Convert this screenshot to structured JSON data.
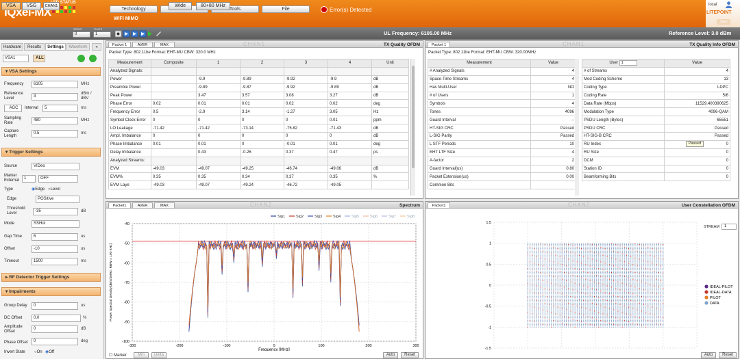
{
  "app": {
    "logo": "IQxel-MX",
    "led_status": "LED STATUS",
    "local": "local",
    "brand": "LITEPOINT",
    "save": "Save"
  },
  "menu": {
    "technology": "Technology",
    "admin": "Admin",
    "tools": "Tools",
    "file": "File",
    "mode": "WIFI MIMO",
    "error": "Error(s) Detected"
  },
  "toolbar": {
    "vsa": "VSA",
    "vsg": "VSG",
    "chan": "CHAN1",
    "select_label": "Select",
    "select_value": "0",
    "count_label": "Count",
    "count_value": "1",
    "wide": "Wide",
    "span": "80+80 MHz",
    "ul_freq": "UL Frequency: 6105.00 MHz",
    "ref_level": "Reference Level: 3.0 dBm"
  },
  "sidebar": {
    "tabs": [
      "Hardware",
      "Results",
      "Settings",
      "Waveform"
    ],
    "vsa_select": "VSA1",
    "all": "ALL",
    "vsa_settings": {
      "title": "VSA Settings",
      "frequency_label": "Frequency",
      "frequency": "6105",
      "frequency_unit": "MHz",
      "ref_label": "Reference Level",
      "ref": "3",
      "ref_unit": "dBm / dBV",
      "agc": "AGC",
      "interval_label": "Interval",
      "interval": "5",
      "interval_unit": "ms",
      "sampling_label": "Sampling Rate",
      "sampling": "480",
      "sampling_unit": "MHz",
      "capture_label": "Capture Length",
      "capture": "0.5",
      "capture_unit": "ms"
    },
    "trigger_settings": {
      "title": "Trigger Settings",
      "source_label": "Source",
      "source": "VIDeo",
      "marker_label": "Marker External",
      "marker_num": "1",
      "marker": "OFF",
      "type_label": "Type",
      "type_edge": "Edge",
      "type_level": "Level",
      "edge_label": "Edge",
      "edge": "POSitive",
      "threshold_label": "Threshold Level",
      "threshold": "-35",
      "threshold_unit": "dB",
      "mode_label": "Mode",
      "mode": "SSHot",
      "gap_label": "Gap Time",
      "gap": "6",
      "gap_unit": "us",
      "offset_label": "Offset",
      "offset": "-10",
      "offset_unit": "us",
      "timeout_label": "Timeout",
      "timeout": "1500",
      "timeout_unit": "ms"
    },
    "rf_trigger": {
      "title": "RF Detector Trigger Settings"
    },
    "impairments": {
      "title": "Impairments",
      "group_label": "Group Delay",
      "group": "0",
      "group_unit": "us",
      "dc_label": "DC Offset",
      "dc": "0.0",
      "dc_unit": "%",
      "amp_label": "Amplitude Offset",
      "amp": "0",
      "amp_unit": "dB",
      "phase_label": "Phase Offset",
      "phase": "0",
      "phase_unit": "deg",
      "invert_label": "Invert State",
      "invert_on": "On",
      "invert_off": "Off"
    }
  },
  "panel_tx": {
    "tabs": [
      "Packet 1",
      "AVER",
      "MAX"
    ],
    "watermark": "CHAN1",
    "title": "TX Quality OFDM",
    "packet_type": "Packet Type: 802.11be   Format: EHT-MU   CBW: 320.0 MHz",
    "headers": [
      "Measurement",
      "Composite",
      "1",
      "2",
      "3",
      "4",
      "Unit"
    ],
    "rows": [
      [
        "Analyzed Signals:",
        "",
        "",
        "",
        "",
        "",
        ""
      ],
      [
        "Power",
        "",
        "-9.9",
        "-9.89",
        "-9.92",
        "-9.9",
        "dB"
      ],
      [
        "Preamble Power",
        "",
        "-9.89",
        "-9.87",
        "-9.92",
        "-9.89",
        "dB"
      ],
      [
        "Peak Power",
        "",
        "3.47",
        "3.57",
        "3.08",
        "3.27",
        "dB"
      ],
      [
        "Phase Error",
        "0.02",
        "0.01",
        "0.01",
        "0.02",
        "0.02",
        "deg"
      ],
      [
        "Frequency Error",
        "0.5",
        "-2.9",
        "3.14",
        "-1.27",
        "3.05",
        "Hz"
      ],
      [
        "Symbol Clock Error",
        "0",
        "0",
        "0",
        "0",
        "0.01",
        "ppm"
      ],
      [
        "LO Leakage",
        "-71.42",
        "-71.42",
        "-73.14",
        "-75.82",
        "-71.43",
        "dB"
      ],
      [
        "Ampl. Imbalance",
        "0",
        "0",
        "0",
        "0",
        "0",
        "dB"
      ],
      [
        "Phase Imbalance",
        "0.01",
        "0.01",
        "0",
        "-0.01",
        "0.01",
        "deg"
      ],
      [
        "Delay Imbalance",
        "",
        "0.43",
        "-0.26",
        "0.37",
        "0.47",
        "ps"
      ],
      [
        "Analyzed Streams:",
        "",
        "",
        "",
        "",
        "",
        ""
      ],
      [
        "EVM",
        "-49.03",
        "-49.07",
        "-49.25",
        "-46.74",
        "-49.06",
        "dB"
      ],
      [
        "EVM%",
        "0.35",
        "0.35",
        "0.34",
        "0.37",
        "0.35",
        "%"
      ],
      [
        "EVM Laye",
        "-49.03",
        "-49.07",
        "-49.24",
        "-46.72",
        "-49.05",
        ""
      ]
    ]
  },
  "panel_info": {
    "tabs": [
      "Packet 1"
    ],
    "watermark": "CHAN1",
    "title": "TX Quality Info OFDM",
    "packet_type": "Packet Type: 802.11be   Format: EHT-MU   CBW: 320.00MHz",
    "left_headers": [
      "Measurement",
      "Value"
    ],
    "left_rows": [
      [
        "# Analyzed Signals",
        "4"
      ],
      [
        "Space-Time Streams",
        "4"
      ],
      [
        "Has Multi-User",
        "NO"
      ],
      [
        "# of Users",
        "1"
      ],
      [
        "Symbols",
        "4"
      ],
      [
        "Tones",
        "4096"
      ],
      [
        "Guard Interval",
        "--"
      ],
      [
        "HT-SIG CRC",
        "Passed"
      ],
      [
        "L-SIG Parity",
        "Passed"
      ],
      [
        "L STF Periods",
        "10"
      ],
      [
        "EHT LTF Size",
        "4"
      ],
      [
        "A-factor",
        "2"
      ],
      [
        "Guard Interval(us)",
        "0.80"
      ],
      [
        "Packet Extension(us)",
        "0.00"
      ],
      [
        "Common Bits",
        ""
      ]
    ],
    "user_label": "User",
    "user_value": "1",
    "right_value_header": "Value",
    "right_rows": [
      [
        "# of Streams",
        "4"
      ],
      [
        "Mod Coding Scheme",
        "13"
      ],
      [
        "Coding Type",
        "LDPC"
      ],
      [
        "Coding Rate",
        "5/6"
      ],
      [
        "Data Rate (Mbps)",
        "11529.400390625"
      ],
      [
        "Modulation Type",
        "4096-QAM"
      ],
      [
        "PSDU Length (Bytes)",
        "65551"
      ],
      [
        "PSDU CRC",
        "Passed"
      ],
      [
        "HT-SIG-B CRC",
        "Passed"
      ],
      [
        "RU Index",
        "0"
      ],
      [
        "RU Size",
        "0"
      ],
      [
        "DCM",
        "0"
      ],
      [
        "Station ID",
        "0"
      ],
      [
        "Beamforming Bits",
        "0"
      ]
    ],
    "tooltip": "Passed"
  },
  "panel_spectrum": {
    "tabs": [
      "Packet1",
      "AVER",
      "MAX"
    ],
    "watermark": "CHAN2",
    "title": "Spectrum",
    "marker": "Marker",
    "min": "Min",
    "delta": "Delta",
    "auto": "Auto",
    "reset": "Reset",
    "colors": [
      "#2b3f9a",
      "#c0392b",
      "#3c4aa8",
      "#e07b22",
      "#9db4e0",
      "#f0b6a0",
      "#b7b7e6",
      "#f3c89a"
    ]
  },
  "panel_const": {
    "tabs": [
      "Packet1"
    ],
    "watermark": "CHAN2",
    "title": "User Constellation OFDM",
    "stream_label": "STREAM",
    "stream_value": "1",
    "auto": "Auto",
    "reset": "Reset"
  },
  "chart_data": [
    {
      "type": "line",
      "title": "Spectrum",
      "xlabel": "Frequency [MHz]",
      "ylabel": "Power Spectral Density[dBm/4MHz, RBW = 100 KHz]",
      "xlim": [
        -300,
        300
      ],
      "ylim": [
        -100,
        -40
      ],
      "xticks": [
        -300,
        -200,
        -100,
        0,
        100,
        200,
        300
      ],
      "yticks": [
        -40,
        -50,
        -60,
        -70,
        -80,
        -90,
        -100
      ],
      "series": [
        {
          "name": "Sig1"
        },
        {
          "name": "Sig2"
        },
        {
          "name": "Sig3"
        },
        {
          "name": "Sig4"
        },
        {
          "name": "Sig5"
        },
        {
          "name": "Sig6"
        },
        {
          "name": "Sig7"
        },
        {
          "name": "Sig8"
        }
      ],
      "mask_level": -49,
      "inband_range": [
        -160,
        160
      ],
      "inband_level": -51,
      "edge_level": -94,
      "notch_x": [
        -140,
        -110,
        -85,
        -55,
        -25,
        5,
        40,
        60,
        95,
        120,
        140
      ],
      "notch_depth": [
        -88,
        -66,
        -60,
        -75,
        -62,
        -58,
        -78,
        -72,
        -64,
        -70,
        -82
      ],
      "grid": true,
      "legend": "top"
    },
    {
      "type": "scatter",
      "title": "User Constellation OFDM",
      "xlim": [
        -1.5,
        1.5
      ],
      "ylim": [
        -1.5,
        1.5
      ],
      "xticks": [
        -1.5,
        -1,
        -0.5,
        0,
        0.5,
        1,
        1.5
      ],
      "yticks": [
        1.5,
        1,
        0.5,
        0,
        -0.5,
        -1,
        -1.5
      ],
      "grid_points": 64,
      "extent": 1,
      "series": [
        {
          "name": "IDEAL-PILOT",
          "color": "#5b2a86"
        },
        {
          "name": "IDEAL-DATA",
          "color": "#c0392b"
        },
        {
          "name": "PILOT",
          "color": "#e67e22"
        },
        {
          "name": "DATA",
          "color": "#7fa4c7"
        }
      ],
      "legend": "right"
    }
  ]
}
